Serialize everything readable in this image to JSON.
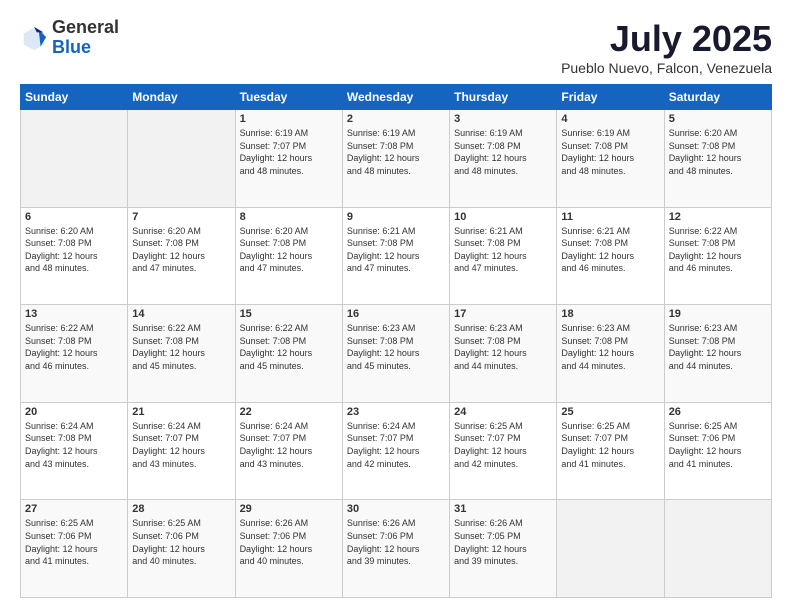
{
  "header": {
    "logo": {
      "general": "General",
      "blue": "Blue"
    },
    "title": "July 2025",
    "subtitle": "Pueblo Nuevo, Falcon, Venezuela"
  },
  "calendar": {
    "days_of_week": [
      "Sunday",
      "Monday",
      "Tuesday",
      "Wednesday",
      "Thursday",
      "Friday",
      "Saturday"
    ],
    "weeks": [
      [
        {
          "day": "",
          "info": "",
          "empty": true
        },
        {
          "day": "",
          "info": "",
          "empty": true
        },
        {
          "day": "1",
          "info": "Sunrise: 6:19 AM\nSunset: 7:07 PM\nDaylight: 12 hours\nand 48 minutes."
        },
        {
          "day": "2",
          "info": "Sunrise: 6:19 AM\nSunset: 7:08 PM\nDaylight: 12 hours\nand 48 minutes."
        },
        {
          "day": "3",
          "info": "Sunrise: 6:19 AM\nSunset: 7:08 PM\nDaylight: 12 hours\nand 48 minutes."
        },
        {
          "day": "4",
          "info": "Sunrise: 6:19 AM\nSunset: 7:08 PM\nDaylight: 12 hours\nand 48 minutes."
        },
        {
          "day": "5",
          "info": "Sunrise: 6:20 AM\nSunset: 7:08 PM\nDaylight: 12 hours\nand 48 minutes."
        }
      ],
      [
        {
          "day": "6",
          "info": "Sunrise: 6:20 AM\nSunset: 7:08 PM\nDaylight: 12 hours\nand 48 minutes."
        },
        {
          "day": "7",
          "info": "Sunrise: 6:20 AM\nSunset: 7:08 PM\nDaylight: 12 hours\nand 47 minutes."
        },
        {
          "day": "8",
          "info": "Sunrise: 6:20 AM\nSunset: 7:08 PM\nDaylight: 12 hours\nand 47 minutes."
        },
        {
          "day": "9",
          "info": "Sunrise: 6:21 AM\nSunset: 7:08 PM\nDaylight: 12 hours\nand 47 minutes."
        },
        {
          "day": "10",
          "info": "Sunrise: 6:21 AM\nSunset: 7:08 PM\nDaylight: 12 hours\nand 47 minutes."
        },
        {
          "day": "11",
          "info": "Sunrise: 6:21 AM\nSunset: 7:08 PM\nDaylight: 12 hours\nand 46 minutes."
        },
        {
          "day": "12",
          "info": "Sunrise: 6:22 AM\nSunset: 7:08 PM\nDaylight: 12 hours\nand 46 minutes."
        }
      ],
      [
        {
          "day": "13",
          "info": "Sunrise: 6:22 AM\nSunset: 7:08 PM\nDaylight: 12 hours\nand 46 minutes."
        },
        {
          "day": "14",
          "info": "Sunrise: 6:22 AM\nSunset: 7:08 PM\nDaylight: 12 hours\nand 45 minutes."
        },
        {
          "day": "15",
          "info": "Sunrise: 6:22 AM\nSunset: 7:08 PM\nDaylight: 12 hours\nand 45 minutes."
        },
        {
          "day": "16",
          "info": "Sunrise: 6:23 AM\nSunset: 7:08 PM\nDaylight: 12 hours\nand 45 minutes."
        },
        {
          "day": "17",
          "info": "Sunrise: 6:23 AM\nSunset: 7:08 PM\nDaylight: 12 hours\nand 44 minutes."
        },
        {
          "day": "18",
          "info": "Sunrise: 6:23 AM\nSunset: 7:08 PM\nDaylight: 12 hours\nand 44 minutes."
        },
        {
          "day": "19",
          "info": "Sunrise: 6:23 AM\nSunset: 7:08 PM\nDaylight: 12 hours\nand 44 minutes."
        }
      ],
      [
        {
          "day": "20",
          "info": "Sunrise: 6:24 AM\nSunset: 7:08 PM\nDaylight: 12 hours\nand 43 minutes."
        },
        {
          "day": "21",
          "info": "Sunrise: 6:24 AM\nSunset: 7:07 PM\nDaylight: 12 hours\nand 43 minutes."
        },
        {
          "day": "22",
          "info": "Sunrise: 6:24 AM\nSunset: 7:07 PM\nDaylight: 12 hours\nand 43 minutes."
        },
        {
          "day": "23",
          "info": "Sunrise: 6:24 AM\nSunset: 7:07 PM\nDaylight: 12 hours\nand 42 minutes."
        },
        {
          "day": "24",
          "info": "Sunrise: 6:25 AM\nSunset: 7:07 PM\nDaylight: 12 hours\nand 42 minutes."
        },
        {
          "day": "25",
          "info": "Sunrise: 6:25 AM\nSunset: 7:07 PM\nDaylight: 12 hours\nand 41 minutes."
        },
        {
          "day": "26",
          "info": "Sunrise: 6:25 AM\nSunset: 7:06 PM\nDaylight: 12 hours\nand 41 minutes."
        }
      ],
      [
        {
          "day": "27",
          "info": "Sunrise: 6:25 AM\nSunset: 7:06 PM\nDaylight: 12 hours\nand 41 minutes."
        },
        {
          "day": "28",
          "info": "Sunrise: 6:25 AM\nSunset: 7:06 PM\nDaylight: 12 hours\nand 40 minutes."
        },
        {
          "day": "29",
          "info": "Sunrise: 6:26 AM\nSunset: 7:06 PM\nDaylight: 12 hours\nand 40 minutes."
        },
        {
          "day": "30",
          "info": "Sunrise: 6:26 AM\nSunset: 7:06 PM\nDaylight: 12 hours\nand 39 minutes."
        },
        {
          "day": "31",
          "info": "Sunrise: 6:26 AM\nSunset: 7:05 PM\nDaylight: 12 hours\nand 39 minutes."
        },
        {
          "day": "",
          "info": "",
          "empty": true
        },
        {
          "day": "",
          "info": "",
          "empty": true
        }
      ]
    ]
  }
}
